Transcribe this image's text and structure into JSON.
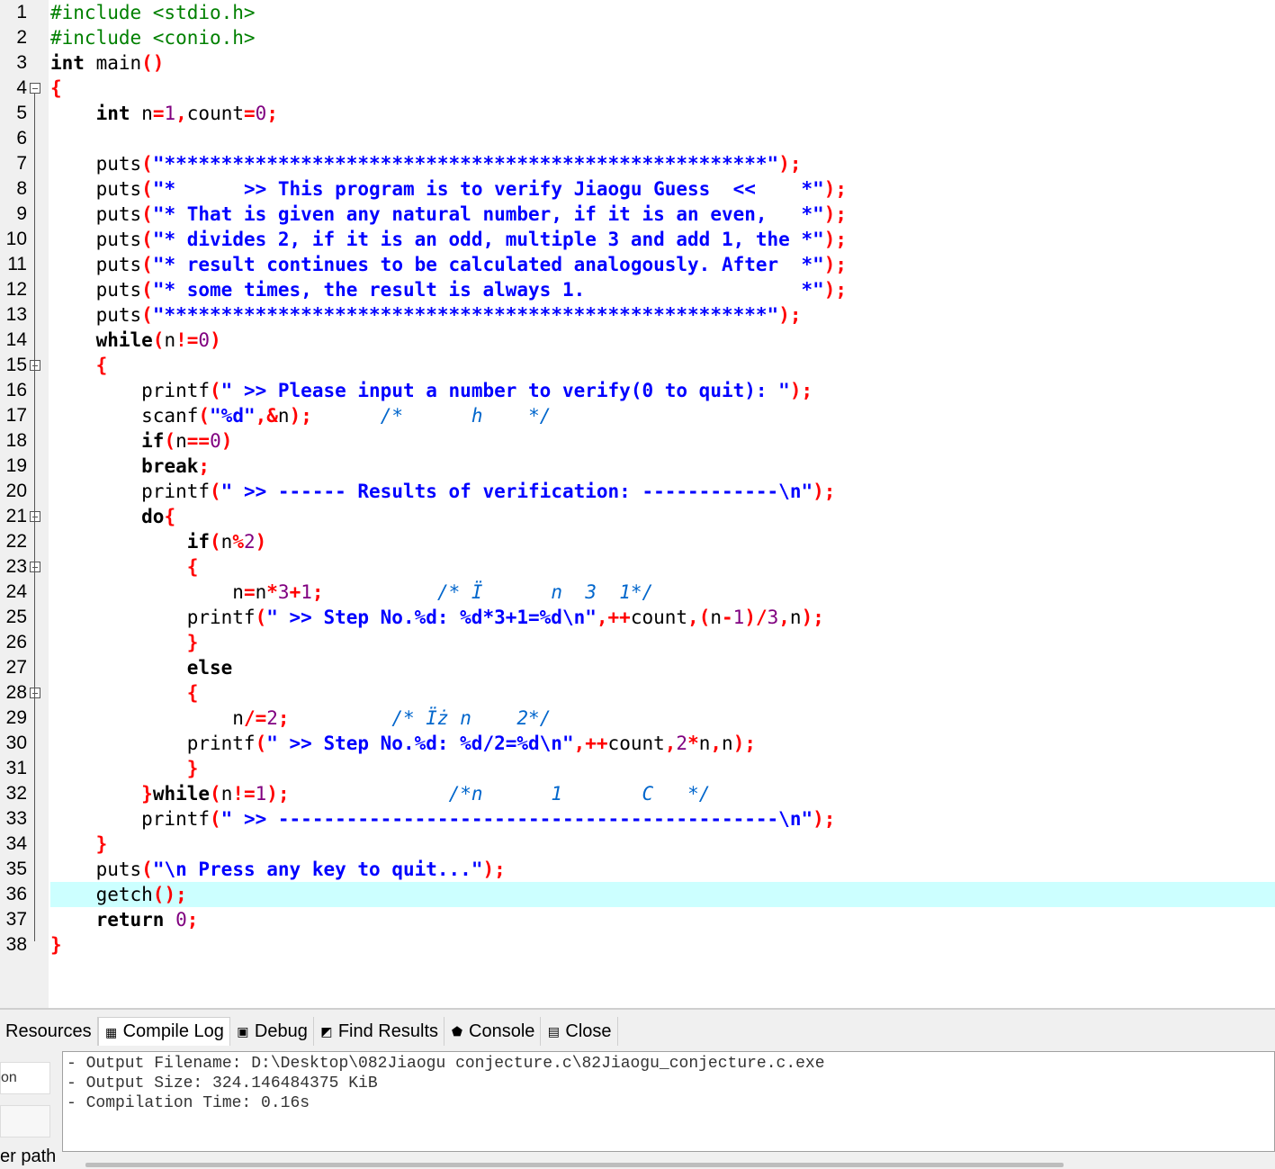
{
  "editor": {
    "current_line": 36,
    "lines": [
      {
        "n": "1",
        "fold": false,
        "segs": [
          [
            "pp",
            "#include <stdio.h>"
          ]
        ]
      },
      {
        "n": "2",
        "fold": false,
        "segs": [
          [
            "pp",
            "#include <conio.h>"
          ]
        ]
      },
      {
        "n": "3",
        "fold": false,
        "segs": [
          [
            "kw",
            "int"
          ],
          [
            "",
            " main"
          ],
          [
            "sym",
            "()"
          ]
        ]
      },
      {
        "n": "4",
        "fold": true,
        "segs": [
          [
            "sym",
            "{"
          ]
        ]
      },
      {
        "n": "5",
        "fold": false,
        "segs": [
          [
            "",
            "    "
          ],
          [
            "kw",
            "int"
          ],
          [
            "",
            " n"
          ],
          [
            "sym",
            "="
          ],
          [
            "num",
            "1"
          ],
          [
            "sym",
            ","
          ],
          [
            "",
            "count"
          ],
          [
            "sym",
            "="
          ],
          [
            "num",
            "0"
          ],
          [
            "sym",
            ";"
          ]
        ]
      },
      {
        "n": "6",
        "fold": false,
        "segs": []
      },
      {
        "n": "7",
        "fold": false,
        "segs": [
          [
            "",
            "    puts"
          ],
          [
            "sym",
            "("
          ],
          [
            "str",
            "\"*****************************************************\""
          ],
          [
            "sym",
            ");"
          ]
        ]
      },
      {
        "n": "8",
        "fold": false,
        "segs": [
          [
            "",
            "    puts"
          ],
          [
            "sym",
            "("
          ],
          [
            "str",
            "\"*      >> This program is to verify Jiaogu Guess  <<    *\""
          ],
          [
            "sym",
            ");"
          ]
        ]
      },
      {
        "n": "9",
        "fold": false,
        "segs": [
          [
            "",
            "    puts"
          ],
          [
            "sym",
            "("
          ],
          [
            "str",
            "\"* That is given any natural number, if it is an even,   *\""
          ],
          [
            "sym",
            ");"
          ]
        ]
      },
      {
        "n": "10",
        "fold": false,
        "segs": [
          [
            "",
            "    puts"
          ],
          [
            "sym",
            "("
          ],
          [
            "str",
            "\"* divides 2, if it is an odd, multiple 3 and add 1, the *\""
          ],
          [
            "sym",
            ");"
          ]
        ]
      },
      {
        "n": "11",
        "fold": false,
        "segs": [
          [
            "",
            "    puts"
          ],
          [
            "sym",
            "("
          ],
          [
            "str",
            "\"* result continues to be calculated analogously. After  *\""
          ],
          [
            "sym",
            ");"
          ]
        ]
      },
      {
        "n": "12",
        "fold": false,
        "segs": [
          [
            "",
            "    puts"
          ],
          [
            "sym",
            "("
          ],
          [
            "str",
            "\"* some times, the result is always 1.                   *\""
          ],
          [
            "sym",
            ");"
          ]
        ]
      },
      {
        "n": "13",
        "fold": false,
        "segs": [
          [
            "",
            "    puts"
          ],
          [
            "sym",
            "("
          ],
          [
            "str",
            "\"*****************************************************\""
          ],
          [
            "sym",
            ");"
          ]
        ]
      },
      {
        "n": "14",
        "fold": false,
        "segs": [
          [
            "",
            "    "
          ],
          [
            "kw",
            "while"
          ],
          [
            "sym",
            "("
          ],
          [
            "",
            "n"
          ],
          [
            "sym",
            "!="
          ],
          [
            "num",
            "0"
          ],
          [
            "sym",
            ")"
          ]
        ]
      },
      {
        "n": "15",
        "fold": true,
        "segs": [
          [
            "",
            "    "
          ],
          [
            "sym",
            "{"
          ]
        ]
      },
      {
        "n": "16",
        "fold": false,
        "segs": [
          [
            "",
            "        printf"
          ],
          [
            "sym",
            "("
          ],
          [
            "str",
            "\" >> Please input a number to verify(0 to quit): \""
          ],
          [
            "sym",
            ");"
          ]
        ]
      },
      {
        "n": "17",
        "fold": false,
        "segs": [
          [
            "",
            "        scanf"
          ],
          [
            "sym",
            "("
          ],
          [
            "str",
            "\"%d\""
          ],
          [
            "sym",
            ",&"
          ],
          [
            "",
            "n"
          ],
          [
            "sym",
            ");"
          ],
          [
            "",
            "      "
          ],
          [
            "cmt",
            "/*      h    */"
          ]
        ]
      },
      {
        "n": "18",
        "fold": false,
        "segs": [
          [
            "",
            "        "
          ],
          [
            "kw",
            "if"
          ],
          [
            "sym",
            "("
          ],
          [
            "",
            "n"
          ],
          [
            "sym",
            "=="
          ],
          [
            "num",
            "0"
          ],
          [
            "sym",
            ")"
          ]
        ]
      },
      {
        "n": "19",
        "fold": false,
        "segs": [
          [
            "",
            "        "
          ],
          [
            "kw",
            "break"
          ],
          [
            "sym",
            ";"
          ]
        ]
      },
      {
        "n": "20",
        "fold": false,
        "segs": [
          [
            "",
            "        printf"
          ],
          [
            "sym",
            "("
          ],
          [
            "str",
            "\" >> ------ Results of verification: ------------\\n\""
          ],
          [
            "sym",
            ");"
          ]
        ]
      },
      {
        "n": "21",
        "fold": true,
        "segs": [
          [
            "",
            "        "
          ],
          [
            "kw",
            "do"
          ],
          [
            "sym",
            "{"
          ]
        ]
      },
      {
        "n": "22",
        "fold": false,
        "segs": [
          [
            "",
            "            "
          ],
          [
            "kw",
            "if"
          ],
          [
            "sym",
            "("
          ],
          [
            "",
            "n"
          ],
          [
            "sym",
            "%"
          ],
          [
            "num",
            "2"
          ],
          [
            "sym",
            ")"
          ]
        ]
      },
      {
        "n": "23",
        "fold": true,
        "segs": [
          [
            "",
            "            "
          ],
          [
            "sym",
            "{"
          ]
        ]
      },
      {
        "n": "24",
        "fold": false,
        "segs": [
          [
            "",
            "                n"
          ],
          [
            "sym",
            "="
          ],
          [
            "",
            "n"
          ],
          [
            "sym",
            "*"
          ],
          [
            "num",
            "3"
          ],
          [
            "sym",
            "+"
          ],
          [
            "num",
            "1"
          ],
          [
            "sym",
            ";"
          ],
          [
            "",
            "          "
          ],
          [
            "cmt",
            "/* Ï      n  3  1*/"
          ]
        ]
      },
      {
        "n": "25",
        "fold": false,
        "segs": [
          [
            "",
            "            printf"
          ],
          [
            "sym",
            "("
          ],
          [
            "str",
            "\" >> Step No.%d: %d*3+1=%d\\n\""
          ],
          [
            "sym",
            ",++"
          ],
          [
            "",
            "count"
          ],
          [
            "sym",
            ",("
          ],
          [
            "",
            "n"
          ],
          [
            "sym",
            "-"
          ],
          [
            "num",
            "1"
          ],
          [
            "sym",
            ")/"
          ],
          [
            "num",
            "3"
          ],
          [
            "sym",
            ","
          ],
          [
            "",
            "n"
          ],
          [
            "sym",
            ");"
          ]
        ]
      },
      {
        "n": "26",
        "fold": false,
        "segs": [
          [
            "",
            "            "
          ],
          [
            "sym",
            "}"
          ]
        ]
      },
      {
        "n": "27",
        "fold": false,
        "segs": [
          [
            "",
            "            "
          ],
          [
            "kw",
            "else"
          ]
        ]
      },
      {
        "n": "28",
        "fold": true,
        "segs": [
          [
            "",
            "            "
          ],
          [
            "sym",
            "{"
          ]
        ]
      },
      {
        "n": "29",
        "fold": false,
        "segs": [
          [
            "",
            "                n"
          ],
          [
            "sym",
            "/="
          ],
          [
            "num",
            "2"
          ],
          [
            "sym",
            ";"
          ],
          [
            "",
            "         "
          ],
          [
            "cmt",
            "/* Ïż n    2*/"
          ]
        ]
      },
      {
        "n": "30",
        "fold": false,
        "segs": [
          [
            "",
            "            printf"
          ],
          [
            "sym",
            "("
          ],
          [
            "str",
            "\" >> Step No.%d: %d/2=%d\\n\""
          ],
          [
            "sym",
            ",++"
          ],
          [
            "",
            "count"
          ],
          [
            "sym",
            ","
          ],
          [
            "num",
            "2"
          ],
          [
            "sym",
            "*"
          ],
          [
            "",
            "n"
          ],
          [
            "sym",
            ","
          ],
          [
            "",
            "n"
          ],
          [
            "sym",
            ");"
          ]
        ]
      },
      {
        "n": "31",
        "fold": false,
        "segs": [
          [
            "",
            "            "
          ],
          [
            "sym",
            "}"
          ]
        ]
      },
      {
        "n": "32",
        "fold": false,
        "segs": [
          [
            "",
            "        "
          ],
          [
            "sym",
            "}"
          ],
          [
            "kw",
            "while"
          ],
          [
            "sym",
            "("
          ],
          [
            "",
            "n"
          ],
          [
            "sym",
            "!="
          ],
          [
            "num",
            "1"
          ],
          [
            "sym",
            ");"
          ],
          [
            "",
            "              "
          ],
          [
            "cmt",
            "/*n      1       C   */"
          ]
        ]
      },
      {
        "n": "33",
        "fold": false,
        "segs": [
          [
            "",
            "        printf"
          ],
          [
            "sym",
            "("
          ],
          [
            "str",
            "\" >> --------------------------------------------\\n\""
          ],
          [
            "sym",
            ");"
          ]
        ]
      },
      {
        "n": "34",
        "fold": false,
        "segs": [
          [
            "",
            "    "
          ],
          [
            "sym",
            "}"
          ]
        ]
      },
      {
        "n": "35",
        "fold": false,
        "segs": [
          [
            "",
            "    puts"
          ],
          [
            "sym",
            "("
          ],
          [
            "str",
            "\"\\n Press any key to quit...\""
          ],
          [
            "sym",
            ");"
          ]
        ]
      },
      {
        "n": "36",
        "fold": false,
        "segs": [
          [
            "",
            "    getch"
          ],
          [
            "sym",
            "();"
          ]
        ]
      },
      {
        "n": "37",
        "fold": false,
        "segs": [
          [
            "",
            "    "
          ],
          [
            "kw",
            "return"
          ],
          [
            "",
            " "
          ],
          [
            "num",
            "0"
          ],
          [
            "sym",
            ";"
          ]
        ]
      },
      {
        "n": "38",
        "fold": false,
        "segs": [
          [
            "sym",
            "}"
          ]
        ]
      }
    ]
  },
  "bottom_panel": {
    "tabs": [
      {
        "label": "Resources",
        "icon": "resources-icon",
        "glyph": ""
      },
      {
        "label": "Compile Log",
        "icon": "compile-log-icon",
        "glyph": "▦"
      },
      {
        "label": "Debug",
        "icon": "debug-icon",
        "glyph": "▣"
      },
      {
        "label": "Find Results",
        "icon": "find-results-icon",
        "glyph": "◩"
      },
      {
        "label": "Console",
        "icon": "console-icon",
        "glyph": "⬟"
      },
      {
        "label": "Close",
        "icon": "close-save-icon",
        "glyph": "▤"
      }
    ],
    "left_panel": {
      "field_top": "on",
      "field_bottom_label": "er path"
    },
    "log_lines": [
      "- Output Filename: D:\\Desktop\\082Jiaogu conjecture.c\\82Jiaogu_conjecture.c.exe",
      "- Output Size: 324.146484375 KiB",
      "- Compilation Time: 0.16s"
    ]
  }
}
